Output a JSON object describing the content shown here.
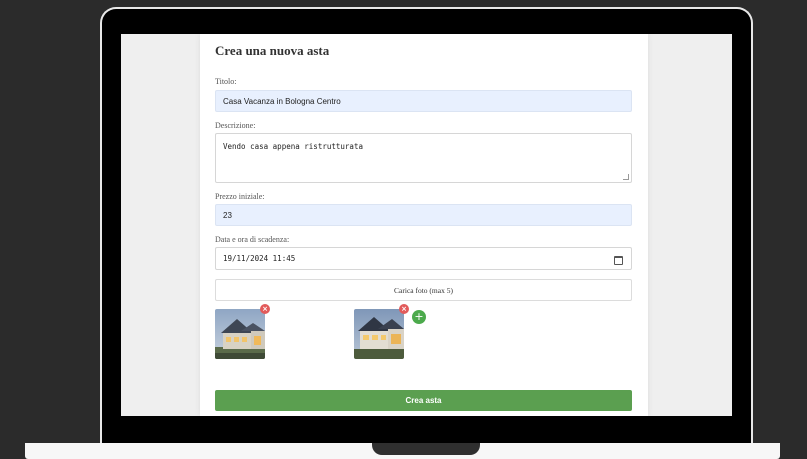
{
  "form": {
    "title": "Crea una nuova asta",
    "titolo_label": "Titolo:",
    "titolo_value": "Casa Vacanza in Bologna Centro",
    "descrizione_label": "Descrizione:",
    "descrizione_value": "Vendo casa appena ristrutturata",
    "prezzo_label": "Prezzo iniziale:",
    "prezzo_value": "23",
    "scadenza_label": "Data e ora di scadenza:",
    "scadenza_value": "19/11/2024 11:45",
    "upload_label": "Carica foto (max 5)",
    "remove_symbol": "×",
    "add_symbol": "+",
    "submit_label": "Crea asta"
  },
  "photos": [
    {
      "icon": "house-photo-1"
    },
    {
      "icon": "house-photo-2"
    }
  ],
  "colors": {
    "submit": "#5b9f50",
    "remove_badge": "#e25b5b",
    "add_button": "#4caa4c",
    "autofill_field": "#e8f0fe"
  }
}
